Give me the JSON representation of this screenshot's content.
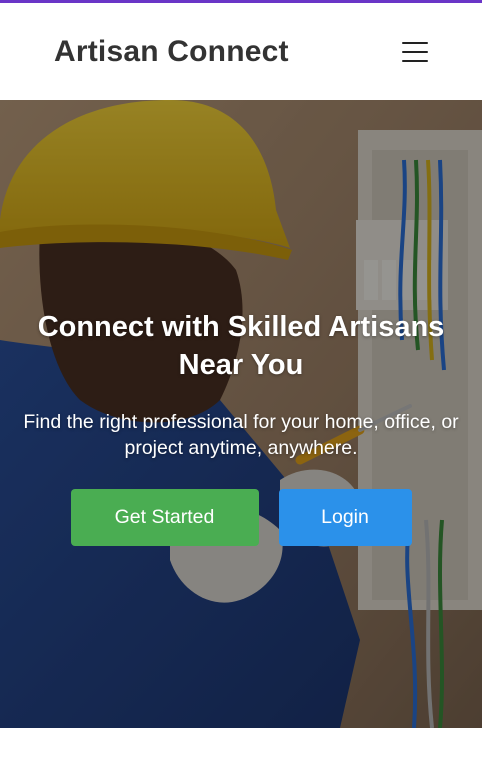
{
  "app": {
    "brand": "Artisan Connect",
    "accent_color": "#6a35c7"
  },
  "nav": {
    "menu_icon": "hamburger-menu-icon"
  },
  "hero": {
    "image": "electrician-with-yellow-hard-hat-working-on-electrical-panel",
    "title": "Connect with Skilled Artisans Near You",
    "subtitle": "Find the right professional for your home, office, or project anytime, anywhere.",
    "buttons": {
      "get_started": "Get Started",
      "login": "Login"
    },
    "colors": {
      "get_started": "#4aad52",
      "login": "#2b91ea"
    }
  }
}
